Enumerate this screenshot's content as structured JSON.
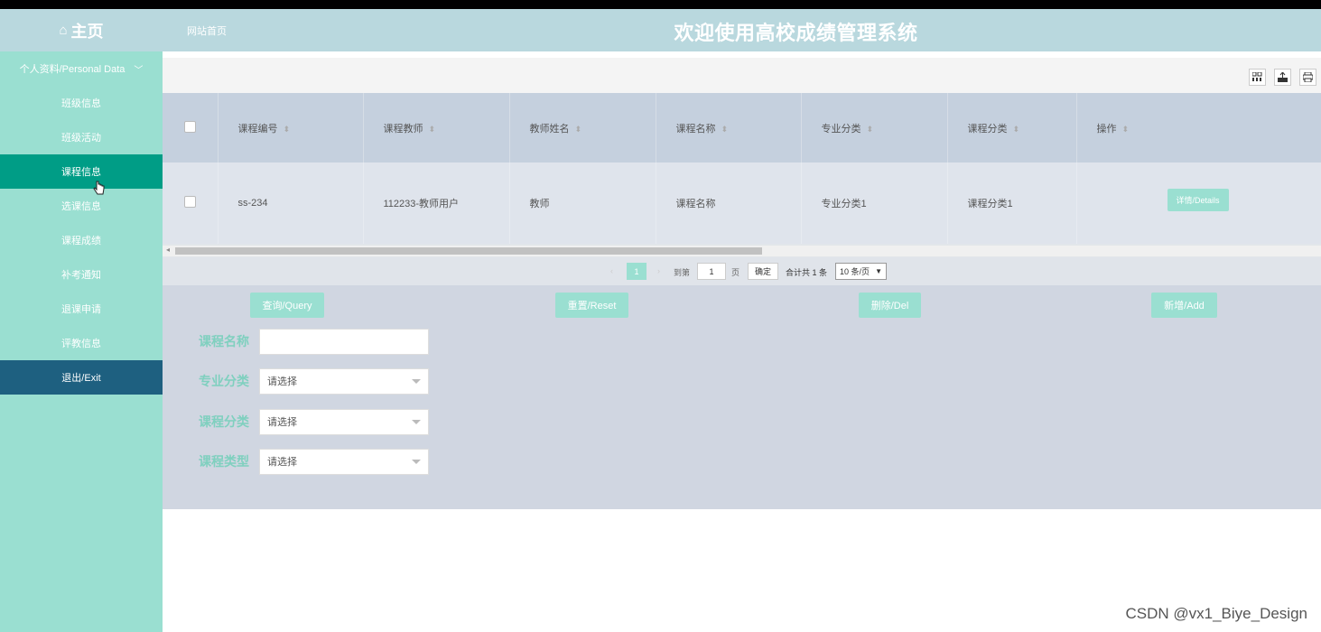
{
  "header": {
    "home_icon": "home-icon",
    "home_label": "主页",
    "site_link": "网站首页",
    "title": "欢迎使用高校成绩管理系统"
  },
  "sidebar": {
    "group_label": "个人资料/Personal Data",
    "items": [
      {
        "label": "班级信息"
      },
      {
        "label": "班级活动"
      },
      {
        "label": "课程信息"
      },
      {
        "label": "选课信息"
      },
      {
        "label": "课程成绩"
      },
      {
        "label": "补考通知"
      },
      {
        "label": "退课申请"
      },
      {
        "label": "评教信息"
      }
    ],
    "active_index": 2,
    "exit_label": "退出/Exit"
  },
  "toolbar": {
    "icons": [
      "grid-icon",
      "export-icon",
      "print-icon"
    ]
  },
  "table": {
    "columns": [
      "课程编号",
      "课程教师",
      "教师姓名",
      "课程名称",
      "专业分类",
      "课程分类",
      "操作"
    ],
    "rows": [
      {
        "cells": [
          "ss-234",
          "112233-教师用户",
          "教师",
          "课程名称",
          "专业分类1",
          "课程分类1"
        ],
        "action_label": "详情/Details"
      }
    ]
  },
  "pager": {
    "current_page": "1",
    "prev": "‹",
    "next": "›",
    "goto_label": "到第",
    "page_input": "1",
    "page_unit": "页",
    "confirm_label": "确定",
    "total_label": "合计共 1 条",
    "page_size": "10 条/页"
  },
  "search": {
    "buttons": {
      "query": "查询/Query",
      "reset": "重置/Reset",
      "delete": "删除/Del",
      "add": "新增/Add"
    },
    "fields": [
      {
        "label": "课程名称",
        "value": ""
      },
      {
        "label": "专业分类",
        "value": "请选择"
      },
      {
        "label": "课程分类",
        "value": "请选择"
      },
      {
        "label": "课程类型",
        "value": "请选择"
      }
    ]
  },
  "watermark": "CSDN @vx1_Biye_Design",
  "colors": {
    "header_bg": "#b9d8de",
    "sidebar_bg": "#9adfd1",
    "sidebar_active": "#009d86",
    "exit_bg": "#1e6080",
    "accent": "#9adfd1"
  }
}
